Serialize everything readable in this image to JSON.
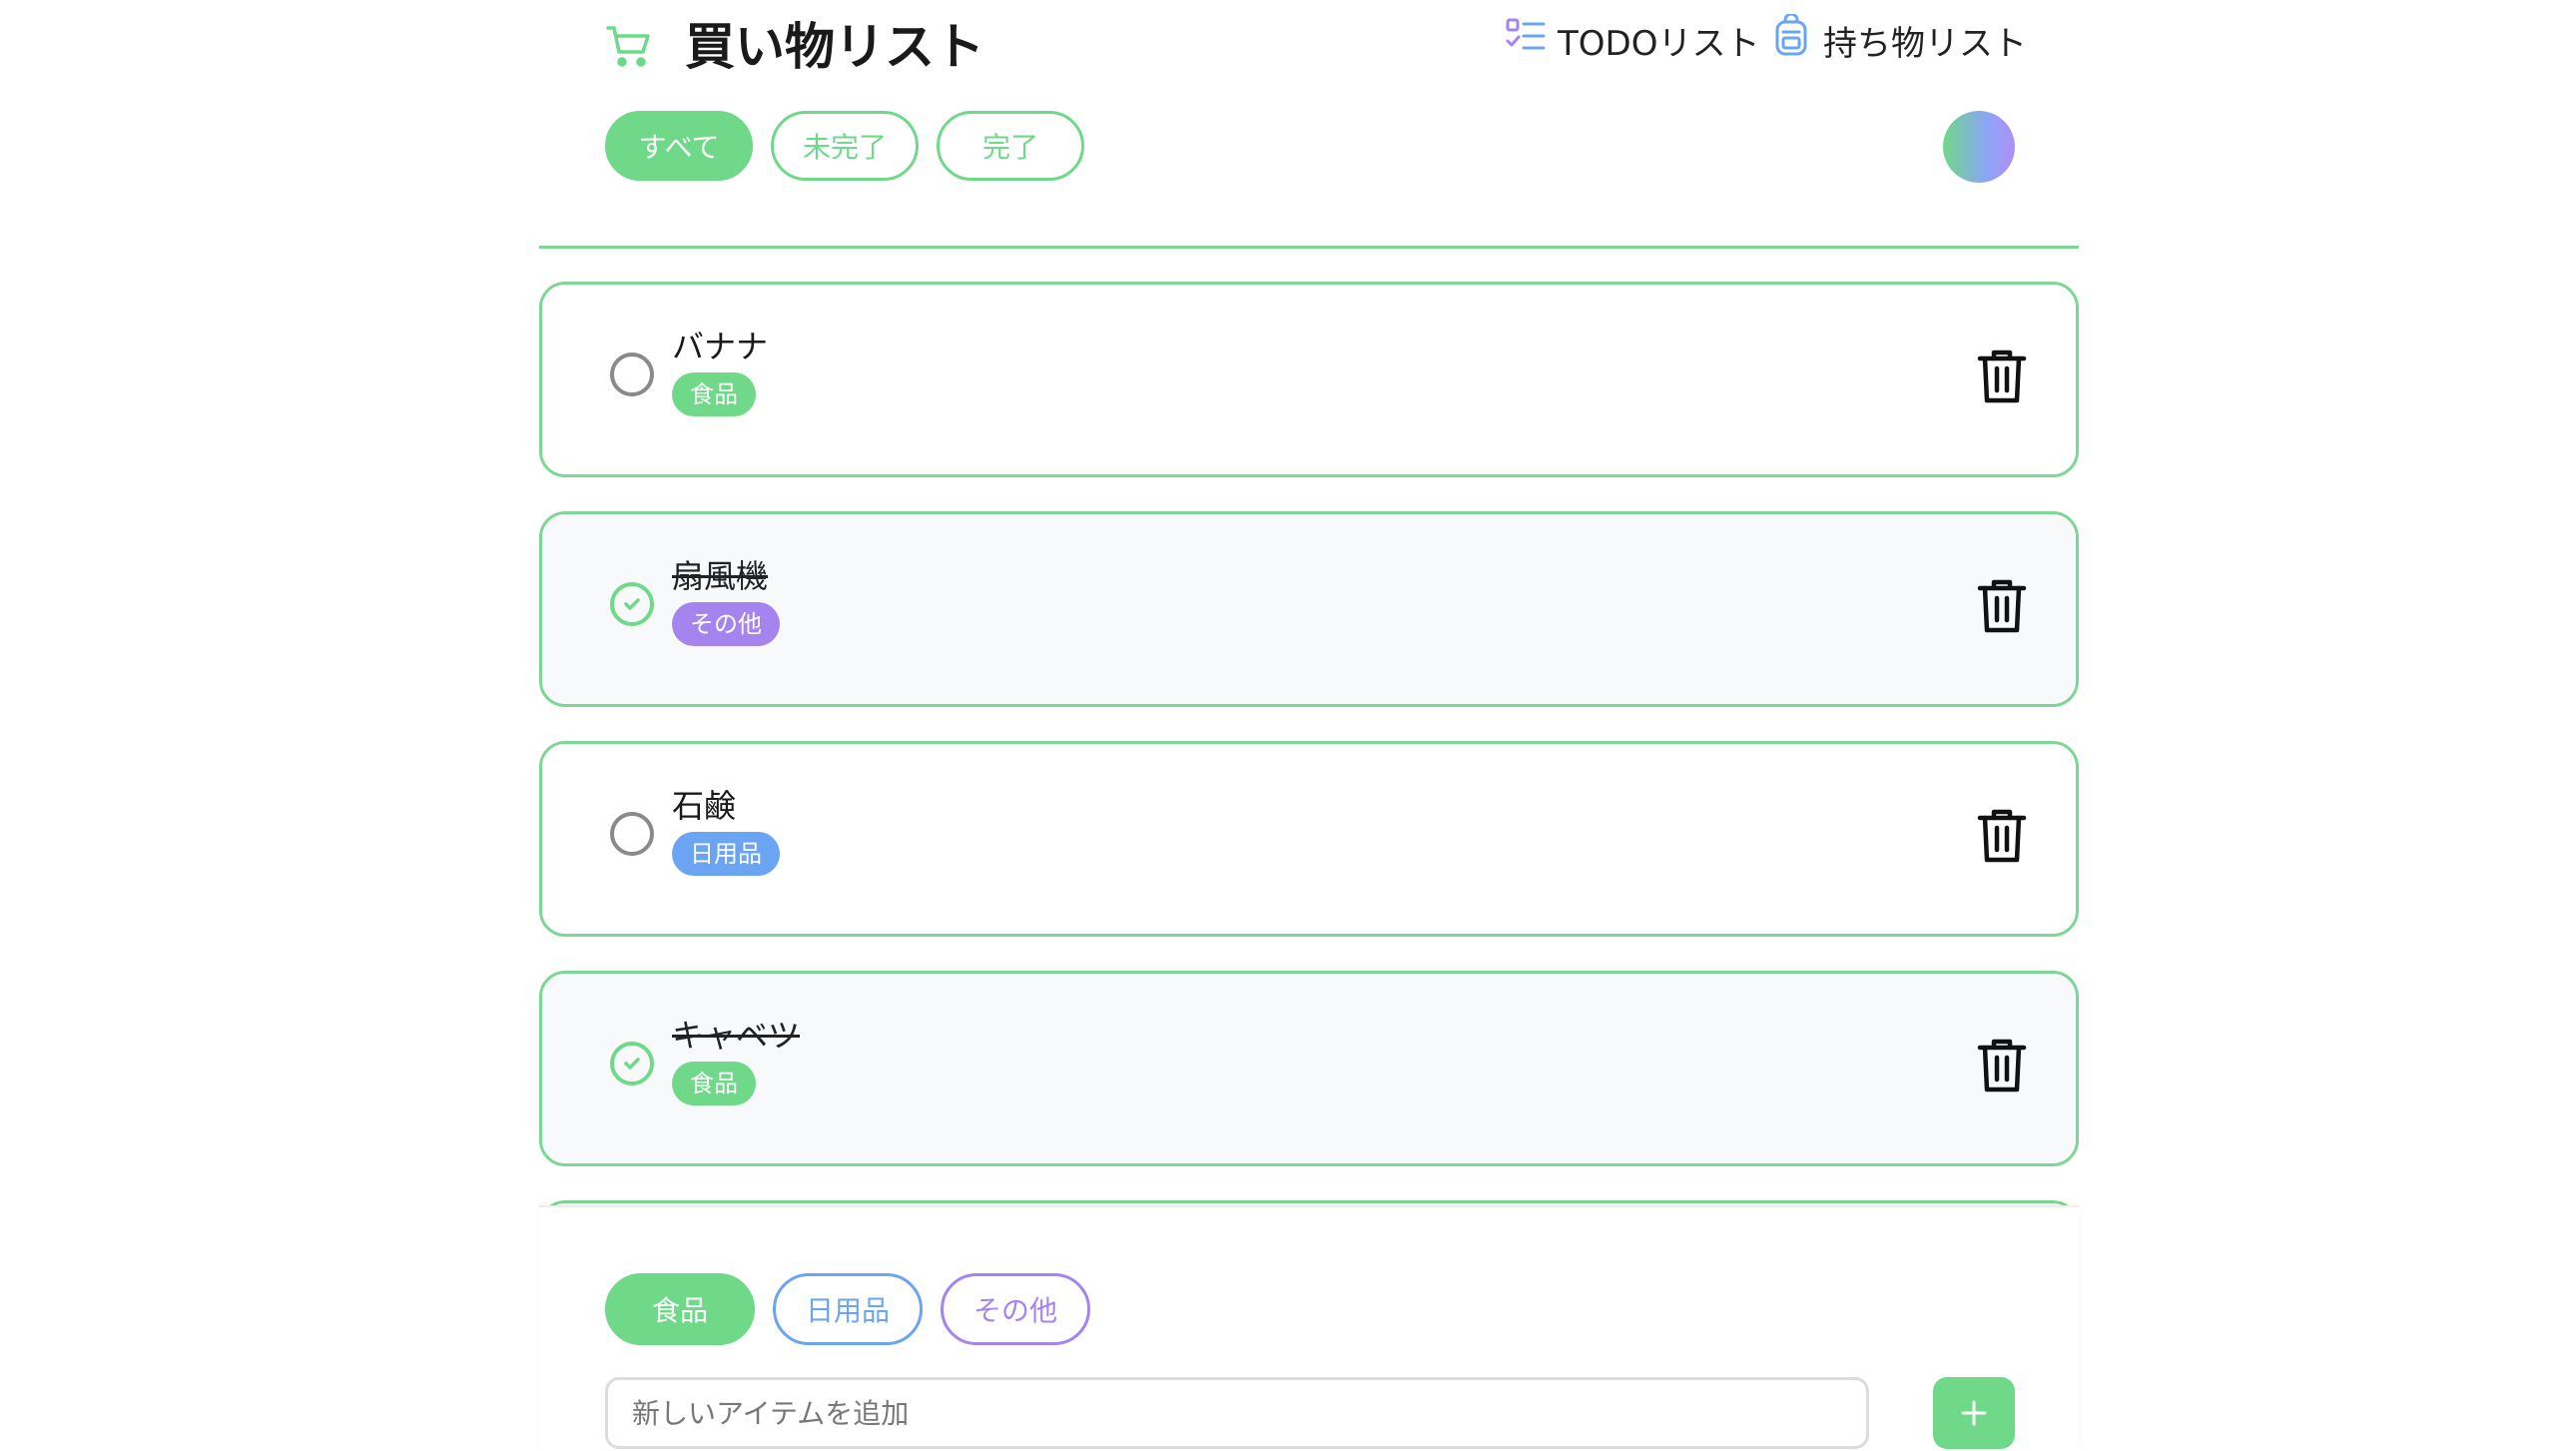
{
  "header": {
    "title": "買い物リスト",
    "nav": [
      {
        "label": "TODOリスト",
        "icon": "checklist-icon"
      },
      {
        "label": "持ち物リスト",
        "icon": "backpack-icon"
      }
    ],
    "filters": [
      {
        "label": "すべて",
        "active": true
      },
      {
        "label": "未完了",
        "active": false
      },
      {
        "label": "完了",
        "active": false
      }
    ]
  },
  "items": [
    {
      "name": "バナナ",
      "tag": "食品",
      "tag_color": "#6fd889",
      "done": false
    },
    {
      "name": "扇風機",
      "tag": "その他",
      "tag_color": "#a684f0",
      "done": true
    },
    {
      "name": "石鹸",
      "tag": "日用品",
      "tag_color": "#6ba4f2",
      "done": false
    },
    {
      "name": "キャベツ",
      "tag": "食品",
      "tag_color": "#6fd889",
      "done": true
    }
  ],
  "composer": {
    "categories": [
      {
        "label": "食品",
        "color": "#6fd889",
        "active": true
      },
      {
        "label": "日用品",
        "color": "#6ba4f2",
        "active": false
      },
      {
        "label": "その他",
        "color": "#a684f0",
        "active": false
      }
    ],
    "placeholder": "新しいアイテムを追加",
    "value": ""
  },
  "colors": {
    "accent": "#6fd889",
    "border": "#7ed694"
  }
}
